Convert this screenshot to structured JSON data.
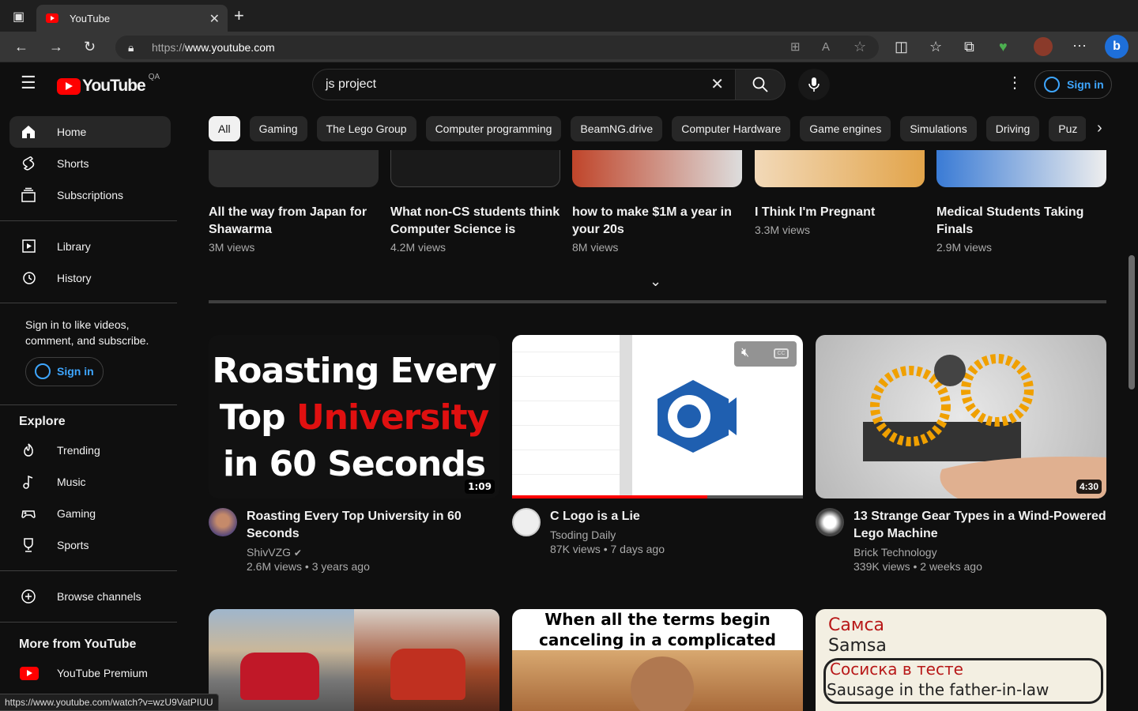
{
  "browser": {
    "tab_title": "YouTube",
    "url_prefix": "https://",
    "url_host": "www.youtube.com",
    "status_url": "https://www.youtube.com/watch?v=wzU9VatPIUU"
  },
  "header": {
    "logo_text": "YouTube",
    "region": "QA",
    "search_value": "js project",
    "signin_label": "Sign in"
  },
  "sidebar": {
    "main": [
      {
        "label": "Home",
        "icon": "home-icon"
      },
      {
        "label": "Shorts",
        "icon": "shorts-icon"
      },
      {
        "label": "Subscriptions",
        "icon": "subscriptions-icon"
      }
    ],
    "library": [
      {
        "label": "Library",
        "icon": "library-icon"
      },
      {
        "label": "History",
        "icon": "history-icon"
      }
    ],
    "signin_prompt": "Sign in to like videos, comment, and subscribe.",
    "signin_label": "Sign in",
    "explore_heading": "Explore",
    "explore": [
      {
        "label": "Trending",
        "icon": "trending-icon"
      },
      {
        "label": "Music",
        "icon": "music-icon"
      },
      {
        "label": "Gaming",
        "icon": "gaming-icon"
      },
      {
        "label": "Sports",
        "icon": "sports-icon"
      }
    ],
    "browse_channels": "Browse channels",
    "more_heading": "More from YouTube",
    "premium": "YouTube Premium"
  },
  "chips": [
    "All",
    "Gaming",
    "The Lego Group",
    "Computer programming",
    "BeamNG.drive",
    "Computer Hardware",
    "Game engines",
    "Simulations",
    "Driving",
    "Puz"
  ],
  "shorts": [
    {
      "title": "All the way from Japan for Shawarma",
      "views": "3M views"
    },
    {
      "title": "What non-CS students think Computer Science is",
      "views": "4.2M views"
    },
    {
      "title": "how to make $1M a year in your 20s",
      "views": "8M views"
    },
    {
      "title": "I Think I'm Pregnant",
      "views": "3.3M views"
    },
    {
      "title": "Medical Students Taking Finals",
      "views": "2.9M views"
    }
  ],
  "videos": [
    {
      "title": "Roasting Every Top University in 60 Seconds",
      "channel": "ShivVZG",
      "meta": "2.6M views • 3 years ago",
      "duration": "1:09",
      "thumb_line1": "Roasting Every",
      "thumb_line2a": "Top ",
      "thumb_line2b": "University",
      "thumb_line3": "in 60 Seconds"
    },
    {
      "title": "C Logo is a Lie",
      "channel": "Tsoding Daily",
      "meta": "87K views • 7 days ago",
      "progress": 0.67
    },
    {
      "title": "13 Strange Gear Types in a Wind-Powered Lego Machine",
      "channel": "Brick Technology",
      "meta": "339K views • 2 weeks ago",
      "duration": "4:30"
    }
  ],
  "row2": {
    "meme_caption": "When all the terms begin canceling in a complicated equation",
    "sign_lines": [
      "Самса",
      "Samsa",
      "Сосиска в тесте",
      "Sausage in the father-in-law"
    ]
  }
}
